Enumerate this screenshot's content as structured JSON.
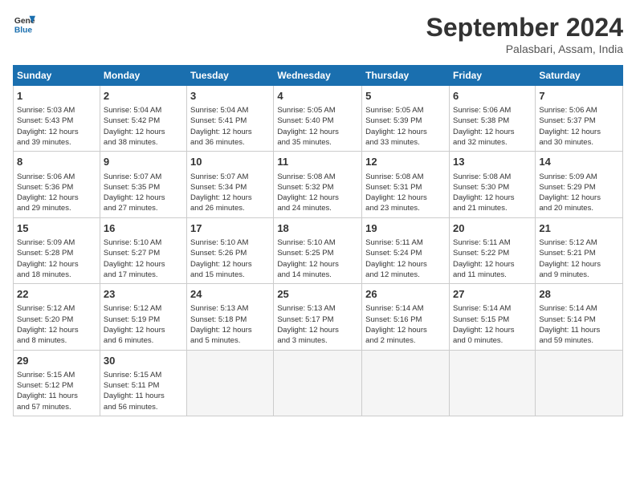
{
  "header": {
    "logo_line1": "General",
    "logo_line2": "Blue",
    "month": "September 2024",
    "location": "Palasbari, Assam, India"
  },
  "weekdays": [
    "Sunday",
    "Monday",
    "Tuesday",
    "Wednesday",
    "Thursday",
    "Friday",
    "Saturday"
  ],
  "weeks": [
    [
      {
        "day": 1,
        "info": "Sunrise: 5:03 AM\nSunset: 5:43 PM\nDaylight: 12 hours\nand 39 minutes."
      },
      {
        "day": 2,
        "info": "Sunrise: 5:04 AM\nSunset: 5:42 PM\nDaylight: 12 hours\nand 38 minutes."
      },
      {
        "day": 3,
        "info": "Sunrise: 5:04 AM\nSunset: 5:41 PM\nDaylight: 12 hours\nand 36 minutes."
      },
      {
        "day": 4,
        "info": "Sunrise: 5:05 AM\nSunset: 5:40 PM\nDaylight: 12 hours\nand 35 minutes."
      },
      {
        "day": 5,
        "info": "Sunrise: 5:05 AM\nSunset: 5:39 PM\nDaylight: 12 hours\nand 33 minutes."
      },
      {
        "day": 6,
        "info": "Sunrise: 5:06 AM\nSunset: 5:38 PM\nDaylight: 12 hours\nand 32 minutes."
      },
      {
        "day": 7,
        "info": "Sunrise: 5:06 AM\nSunset: 5:37 PM\nDaylight: 12 hours\nand 30 minutes."
      }
    ],
    [
      {
        "day": 8,
        "info": "Sunrise: 5:06 AM\nSunset: 5:36 PM\nDaylight: 12 hours\nand 29 minutes."
      },
      {
        "day": 9,
        "info": "Sunrise: 5:07 AM\nSunset: 5:35 PM\nDaylight: 12 hours\nand 27 minutes."
      },
      {
        "day": 10,
        "info": "Sunrise: 5:07 AM\nSunset: 5:34 PM\nDaylight: 12 hours\nand 26 minutes."
      },
      {
        "day": 11,
        "info": "Sunrise: 5:08 AM\nSunset: 5:32 PM\nDaylight: 12 hours\nand 24 minutes."
      },
      {
        "day": 12,
        "info": "Sunrise: 5:08 AM\nSunset: 5:31 PM\nDaylight: 12 hours\nand 23 minutes."
      },
      {
        "day": 13,
        "info": "Sunrise: 5:08 AM\nSunset: 5:30 PM\nDaylight: 12 hours\nand 21 minutes."
      },
      {
        "day": 14,
        "info": "Sunrise: 5:09 AM\nSunset: 5:29 PM\nDaylight: 12 hours\nand 20 minutes."
      }
    ],
    [
      {
        "day": 15,
        "info": "Sunrise: 5:09 AM\nSunset: 5:28 PM\nDaylight: 12 hours\nand 18 minutes."
      },
      {
        "day": 16,
        "info": "Sunrise: 5:10 AM\nSunset: 5:27 PM\nDaylight: 12 hours\nand 17 minutes."
      },
      {
        "day": 17,
        "info": "Sunrise: 5:10 AM\nSunset: 5:26 PM\nDaylight: 12 hours\nand 15 minutes."
      },
      {
        "day": 18,
        "info": "Sunrise: 5:10 AM\nSunset: 5:25 PM\nDaylight: 12 hours\nand 14 minutes."
      },
      {
        "day": 19,
        "info": "Sunrise: 5:11 AM\nSunset: 5:24 PM\nDaylight: 12 hours\nand 12 minutes."
      },
      {
        "day": 20,
        "info": "Sunrise: 5:11 AM\nSunset: 5:22 PM\nDaylight: 12 hours\nand 11 minutes."
      },
      {
        "day": 21,
        "info": "Sunrise: 5:12 AM\nSunset: 5:21 PM\nDaylight: 12 hours\nand 9 minutes."
      }
    ],
    [
      {
        "day": 22,
        "info": "Sunrise: 5:12 AM\nSunset: 5:20 PM\nDaylight: 12 hours\nand 8 minutes."
      },
      {
        "day": 23,
        "info": "Sunrise: 5:12 AM\nSunset: 5:19 PM\nDaylight: 12 hours\nand 6 minutes."
      },
      {
        "day": 24,
        "info": "Sunrise: 5:13 AM\nSunset: 5:18 PM\nDaylight: 12 hours\nand 5 minutes."
      },
      {
        "day": 25,
        "info": "Sunrise: 5:13 AM\nSunset: 5:17 PM\nDaylight: 12 hours\nand 3 minutes."
      },
      {
        "day": 26,
        "info": "Sunrise: 5:14 AM\nSunset: 5:16 PM\nDaylight: 12 hours\nand 2 minutes."
      },
      {
        "day": 27,
        "info": "Sunrise: 5:14 AM\nSunset: 5:15 PM\nDaylight: 12 hours\nand 0 minutes."
      },
      {
        "day": 28,
        "info": "Sunrise: 5:14 AM\nSunset: 5:14 PM\nDaylight: 11 hours\nand 59 minutes."
      }
    ],
    [
      {
        "day": 29,
        "info": "Sunrise: 5:15 AM\nSunset: 5:12 PM\nDaylight: 11 hours\nand 57 minutes."
      },
      {
        "day": 30,
        "info": "Sunrise: 5:15 AM\nSunset: 5:11 PM\nDaylight: 11 hours\nand 56 minutes."
      },
      null,
      null,
      null,
      null,
      null
    ]
  ]
}
